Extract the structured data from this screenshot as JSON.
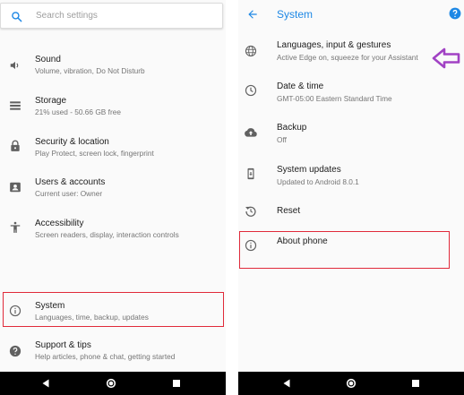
{
  "colors": {
    "accent": "#1e88e5",
    "highlight": "#e02a3a",
    "arrow": "#a142c4",
    "icon": "#616161",
    "title_text": "#202020",
    "subtitle_text": "#757575"
  },
  "left": {
    "search": {
      "placeholder": "Search settings",
      "icon": "search-icon"
    },
    "items": [
      {
        "title": "Sound",
        "subtitle": "Volume, vibration, Do Not Disturb",
        "icon": "volume-icon"
      },
      {
        "title": "Storage",
        "subtitle": "21% used - 50.66 GB free",
        "icon": "storage-icon"
      },
      {
        "title": "Security & location",
        "subtitle": "Play Protect, screen lock, fingerprint",
        "icon": "lock-icon"
      },
      {
        "title": "Users & accounts",
        "subtitle": "Current user: Owner",
        "icon": "account-icon"
      },
      {
        "title": "Accessibility",
        "subtitle": "Screen readers, display, interaction controls",
        "icon": "accessibility-icon"
      },
      {
        "title": "System",
        "subtitle": "Languages, time, backup, updates",
        "icon": "info-icon"
      },
      {
        "title": "Support & tips",
        "subtitle": "Help articles, phone & chat, getting started",
        "icon": "help-icon"
      }
    ]
  },
  "right": {
    "header": {
      "title": "System",
      "back_icon": "back-arrow-icon",
      "help_icon": "help-icon"
    },
    "items": [
      {
        "title": "Languages, input & gestures",
        "subtitle": "Active Edge on, squeeze for your Assistant",
        "icon": "globe-icon"
      },
      {
        "title": "Date & time",
        "subtitle": "GMT-05:00 Eastern Standard Time",
        "icon": "clock-icon"
      },
      {
        "title": "Backup",
        "subtitle": "Off",
        "icon": "cloud-upload-icon"
      },
      {
        "title": "System updates",
        "subtitle": "Updated to Android 8.0.1",
        "icon": "phone-update-icon"
      },
      {
        "title": "Reset",
        "subtitle": "",
        "icon": "reset-icon"
      },
      {
        "title": "About phone",
        "subtitle": "",
        "icon": "info-icon"
      }
    ]
  },
  "navbar": {
    "back": "nav-back-icon",
    "home": "nav-home-icon",
    "recents": "nav-recents-icon"
  }
}
